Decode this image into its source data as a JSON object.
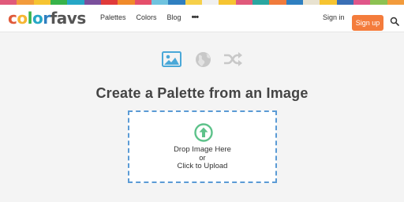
{
  "color_strip": [
    "#e05a7b",
    "#f29b3c",
    "#f6c431",
    "#37b34a",
    "#26a7c6",
    "#7a4f9c",
    "#e03a3a",
    "#f08a2a",
    "#e54f6b",
    "#6fc3df",
    "#2f7fc0",
    "#f6d04a",
    "#f0f0f0",
    "#f6c431",
    "#e05a7b",
    "#2aa6a0",
    "#f07b3c",
    "#2f7fc0",
    "#e8e2d0",
    "#f6c431",
    "#3a6fb5",
    "#e0568a",
    "#8cc152",
    "#f29b3c"
  ],
  "brand": {
    "letters": [
      {
        "ch": "c",
        "color": "#e05a3a"
      },
      {
        "ch": "o",
        "color": "#f6b531"
      },
      {
        "ch": "l",
        "color": "#37b34a"
      },
      {
        "ch": "o",
        "color": "#26a7c6"
      },
      {
        "ch": "r",
        "color": "#2f7fc0"
      },
      {
        "ch": "f",
        "color": "#555555"
      },
      {
        "ch": "a",
        "color": "#555555"
      },
      {
        "ch": "v",
        "color": "#555555"
      },
      {
        "ch": "s",
        "color": "#555555"
      }
    ]
  },
  "nav": {
    "palettes": "Palettes",
    "colors": "Colors",
    "blog": "Blog",
    "more": "•••"
  },
  "account": {
    "sign_in": "Sign in",
    "sign_up": "Sign up"
  },
  "colors": {
    "accent": "#f47c3c",
    "dropzone_border": "#5b9bd5",
    "upload_icon": "#5dc28a",
    "active_mode_icon": "#4aa8d8",
    "inactive_mode_icon": "#c8c8c8"
  },
  "modes": [
    {
      "icon": "image-icon",
      "active": true
    },
    {
      "icon": "globe-icon",
      "active": false
    },
    {
      "icon": "shuffle-icon",
      "active": false
    }
  ],
  "main": {
    "title": "Create a Palette from an Image"
  },
  "dropzone": {
    "icon": "upload-arrow-icon",
    "line1": "Drop Image Here",
    "line2": "or",
    "line3": "Click to Upload"
  }
}
